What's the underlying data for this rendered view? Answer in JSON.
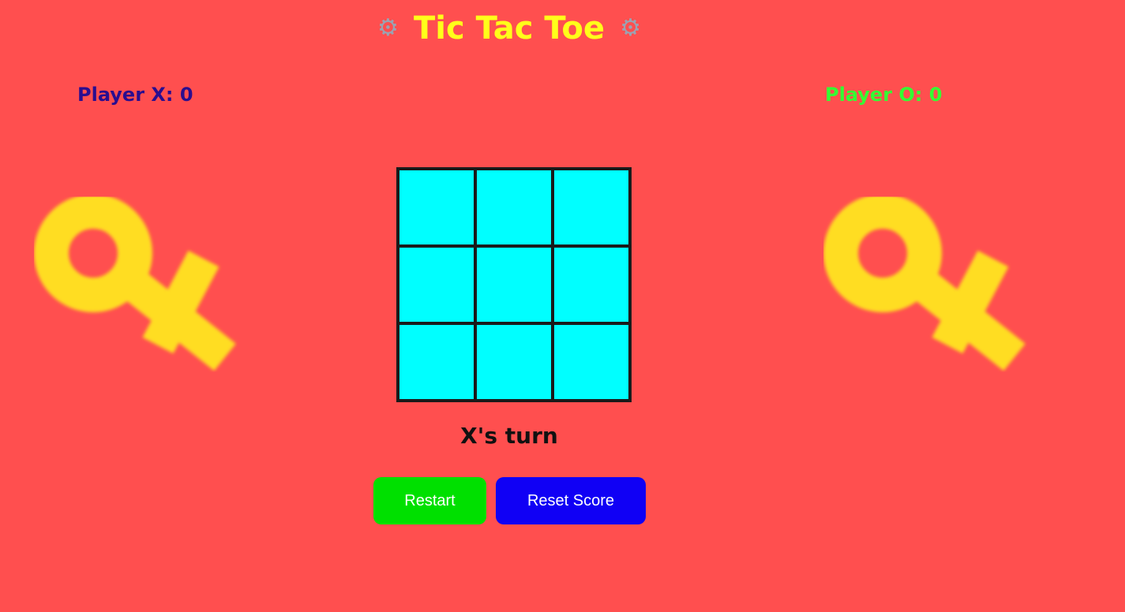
{
  "header": {
    "title": "Tic Tac Toe",
    "left_icon": "gear-icon",
    "right_icon": "gear-icon"
  },
  "scores": {
    "x_label": "Player X: 0",
    "o_label": "Player O: 0",
    "x_color": "#2a0d8f",
    "o_color": "#33ff33"
  },
  "decorations": {
    "left_icon": "female-symbol-icon",
    "right_icon": "female-symbol-icon",
    "color": "#ffdd22"
  },
  "board": {
    "cells": [
      "",
      "",
      "",
      "",
      "",
      "",
      "",
      "",
      ""
    ],
    "cell_color": "#00ffff"
  },
  "status": {
    "text": "X's turn"
  },
  "buttons": {
    "restart_label": "Restart",
    "restart_color": "#00e000",
    "reset_label": "Reset Score",
    "reset_color": "#1000f5"
  },
  "colors": {
    "background": "#ff4f4f",
    "title": "#ffff1a"
  }
}
